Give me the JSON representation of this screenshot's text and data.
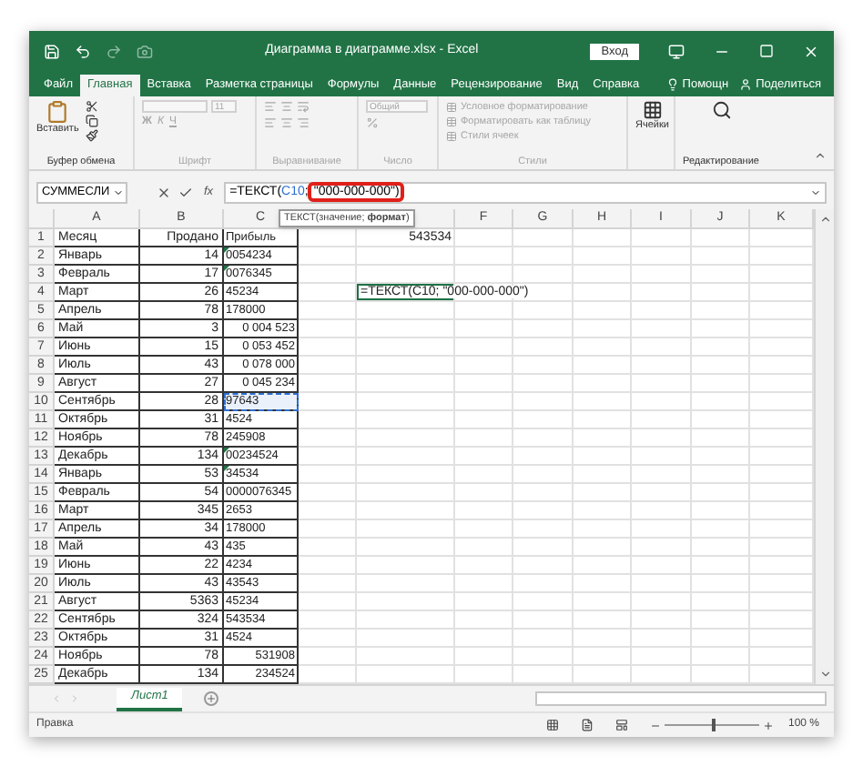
{
  "title_bar": {
    "title": "Диаграмма в диаграмме.xlsx - Excel",
    "sign_in": "Вход"
  },
  "ribbon_tabs": [
    {
      "label": "Файл",
      "selected": false
    },
    {
      "label": "Главная",
      "selected": true
    },
    {
      "label": "Вставка",
      "selected": false
    },
    {
      "label": "Разметка страницы",
      "selected": false
    },
    {
      "label": "Формулы",
      "selected": false
    },
    {
      "label": "Данные",
      "selected": false
    },
    {
      "label": "Рецензирование",
      "selected": false
    },
    {
      "label": "Вид",
      "selected": false
    },
    {
      "label": "Справка",
      "selected": false
    }
  ],
  "tell_me": "Помощн",
  "share": "Поделиться",
  "ribbon_groups": [
    {
      "kind": "clipboard",
      "label": "Буфер обмена",
      "button": "Вставить",
      "disabled": false
    },
    {
      "kind": "font",
      "label": "Шрифт",
      "size": "11",
      "bold": "Ж",
      "italic": "К",
      "underline": "Ч",
      "disabled": true
    },
    {
      "kind": "alignment",
      "label": "Выравнивание",
      "disabled": true
    },
    {
      "kind": "number",
      "label": "Число",
      "format": "Общий",
      "disabled": true
    },
    {
      "kind": "styles",
      "label": "Стили",
      "items": [
        "Условное форматирование",
        "Форматировать как таблицу",
        "Стили ячеек"
      ],
      "disabled": true
    },
    {
      "kind": "cells",
      "label": "Ячейки",
      "disabled": false
    },
    {
      "kind": "editing",
      "label": "Редактирование",
      "disabled": false
    }
  ],
  "formula_bar": {
    "name_box": "СУММЕСЛИ",
    "function_button": "fx",
    "formula_start": "=ТЕКСТ(",
    "formula_ref": "C10",
    "formula_sep": ";",
    "formula_highlighted": " \"000-000-000\")"
  },
  "tooltip": "ТЕКСТ(значение; **формат**)",
  "column_headers_left": [
    "A",
    "B",
    "C"
  ],
  "column_headers_right": [
    "F",
    "G",
    "H",
    "I",
    "J",
    "K"
  ],
  "rows": [
    {
      "number": "1",
      "month": "Месяц",
      "sold": "Продано",
      "profit": "Прибыль",
      "right_aligned": false,
      "text_flag": false,
      "referenced": false,
      "column_e": {
        "text": "543534",
        "editing": false
      }
    },
    {
      "number": "2",
      "month": "Январь",
      "sold": "14",
      "profit": "0054234",
      "right_aligned": false,
      "text_flag": true,
      "referenced": false
    },
    {
      "number": "3",
      "month": "Февраль",
      "sold": "17",
      "profit": "0076345",
      "right_aligned": false,
      "text_flag": true,
      "referenced": false
    },
    {
      "number": "4",
      "month": "Март",
      "sold": "26",
      "profit": "45234",
      "right_aligned": false,
      "text_flag": false,
      "referenced": false,
      "column_e": {
        "text": "=ТЕКСТ(C10; \"000-000-000\")",
        "editing": true
      }
    },
    {
      "number": "5",
      "month": "Апрель",
      "sold": "78",
      "profit": "178000",
      "right_aligned": false,
      "text_flag": false,
      "referenced": false
    },
    {
      "number": "6",
      "month": "Май",
      "sold": "3",
      "profit": "0 004 523",
      "right_aligned": true,
      "text_flag": false,
      "referenced": false
    },
    {
      "number": "7",
      "month": "Июнь",
      "sold": "15",
      "profit": "0 053 452",
      "right_aligned": true,
      "text_flag": false,
      "referenced": false
    },
    {
      "number": "8",
      "month": "Июль",
      "sold": "43",
      "profit": "0 078 000",
      "right_aligned": true,
      "text_flag": false,
      "referenced": false
    },
    {
      "number": "9",
      "month": "Август",
      "sold": "27",
      "profit": "0 045 234",
      "right_aligned": true,
      "text_flag": false,
      "referenced": false
    },
    {
      "number": "10",
      "month": "Сентябрь",
      "sold": "28",
      "profit": "97643",
      "right_aligned": false,
      "text_flag": false,
      "referenced": true
    },
    {
      "number": "11",
      "month": "Октябрь",
      "sold": "31",
      "profit": "4524",
      "right_aligned": false,
      "text_flag": false,
      "referenced": false
    },
    {
      "number": "12",
      "month": "Ноябрь",
      "sold": "78",
      "profit": "245908",
      "right_aligned": false,
      "text_flag": false,
      "referenced": false
    },
    {
      "number": "13",
      "month": "Декабрь",
      "sold": "134",
      "profit": "00234524",
      "right_aligned": false,
      "text_flag": true,
      "referenced": false
    },
    {
      "number": "14",
      "month": "Январь",
      "sold": "53",
      "profit": "34534",
      "right_aligned": false,
      "text_flag": true,
      "referenced": false
    },
    {
      "number": "15",
      "month": "Февраль",
      "sold": "54",
      "profit": "0000076345",
      "right_aligned": false,
      "text_flag": false,
      "referenced": false
    },
    {
      "number": "16",
      "month": "Март",
      "sold": "345",
      "profit": "2653",
      "right_aligned": false,
      "text_flag": false,
      "referenced": false
    },
    {
      "number": "17",
      "month": "Апрель",
      "sold": "34",
      "profit": "178000",
      "right_aligned": false,
      "text_flag": false,
      "referenced": false
    },
    {
      "number": "18",
      "month": "Май",
      "sold": "43",
      "profit": "435",
      "right_aligned": false,
      "text_flag": false,
      "referenced": false
    },
    {
      "number": "19",
      "month": "Июнь",
      "sold": "22",
      "profit": "4234",
      "right_aligned": false,
      "text_flag": false,
      "referenced": false
    },
    {
      "number": "20",
      "month": "Июль",
      "sold": "43",
      "profit": "43543",
      "right_aligned": false,
      "text_flag": false,
      "referenced": false
    },
    {
      "number": "21",
      "month": "Август",
      "sold": "5363",
      "profit": "45234",
      "right_aligned": false,
      "text_flag": false,
      "referenced": false
    },
    {
      "number": "22",
      "month": "Сентябрь",
      "sold": "324",
      "profit": "543534",
      "right_aligned": false,
      "text_flag": false,
      "referenced": false
    },
    {
      "number": "23",
      "month": "Октябрь",
      "sold": "31",
      "profit": "4524",
      "right_aligned": false,
      "text_flag": false,
      "referenced": false
    },
    {
      "number": "24",
      "month": "Ноябрь",
      "sold": "78",
      "profit": "531908",
      "right_aligned": true,
      "text_flag": false,
      "referenced": false
    },
    {
      "number": "25",
      "month": "Декабрь",
      "sold": "134",
      "profit": "234524",
      "right_aligned": true,
      "text_flag": false,
      "referenced": false
    }
  ],
  "sheet_tabs": [
    {
      "label": "Лист1",
      "selected": true
    }
  ],
  "status_bar": {
    "mode": "Правка",
    "zoom": "100 %",
    "zoom_slider": {
      "level": 0.5
    }
  }
}
